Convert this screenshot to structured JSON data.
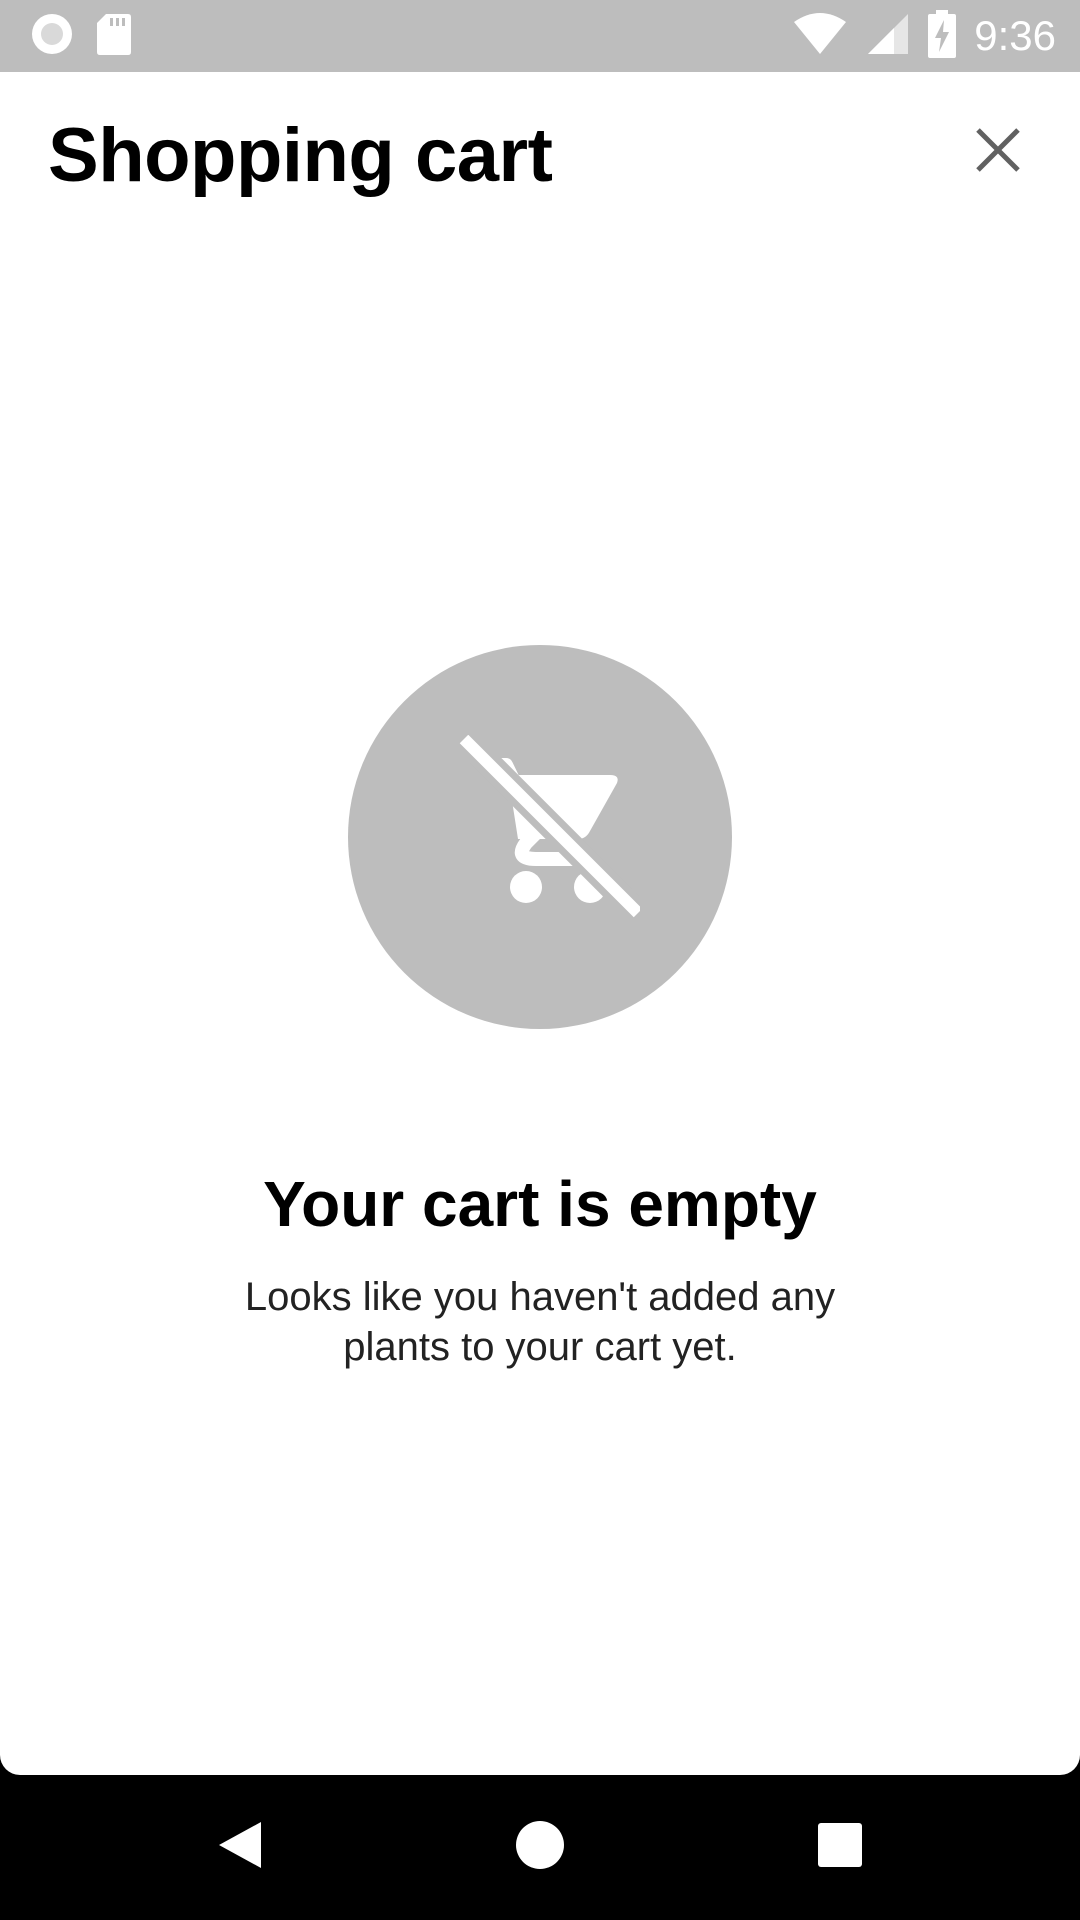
{
  "status_bar": {
    "time": "9:36",
    "left_icons": [
      "record-icon",
      "sd-card-icon"
    ],
    "right_icons": [
      "wifi-icon",
      "cellular-signal-icon",
      "battery-charging-icon"
    ]
  },
  "header": {
    "title": "Shopping cart",
    "close_icon": "close-icon"
  },
  "empty_state": {
    "icon": "remove-shopping-cart-icon",
    "title": "Your cart is empty",
    "description": "Looks like you haven't added any plants to your cart yet."
  },
  "nav_bar": {
    "buttons": [
      "back-icon",
      "home-icon",
      "recents-icon"
    ]
  },
  "colors": {
    "status_bar_bg": "#bdbdbd",
    "sheet_bg": "#ffffff",
    "icon_circle_bg": "#bdbdbd",
    "nav_bar_bg": "#000000"
  }
}
